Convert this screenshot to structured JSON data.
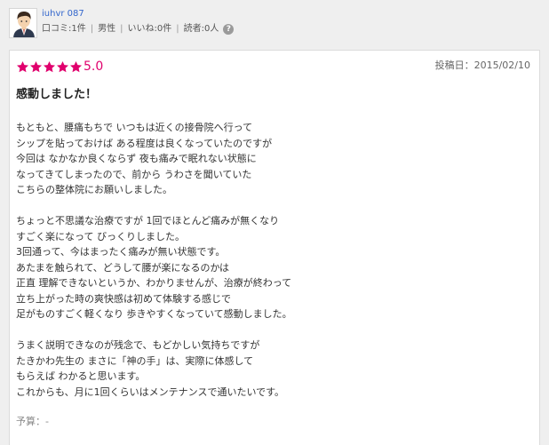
{
  "user": {
    "name": "iuhvr 087",
    "stats": [
      "口コミ:1件",
      "男性",
      "いいね:0件",
      "読者:0人"
    ],
    "help_icon": "question-circle-icon"
  },
  "review": {
    "rating": 5,
    "rating_label": "5.0",
    "post_date": "投稿日：2015/02/10",
    "title": "感動しました！",
    "paragraphs": [
      [
        "もともと、腰痛もちで いつもは近くの接骨院へ行って",
        "シップを貼っておけば ある程度は良くなっていたのですが",
        "今回は なかなか良くならず 夜も痛みで眠れない状態に",
        "なってきてしまったので、前から うわさを聞いていた",
        "こちらの整体院にお願いしました。"
      ],
      [
        "ちょっと不思議な治療ですが 1回でほとんど痛みが無くなり",
        "すごく楽になって びっくりしました。",
        "3回通って、今はまったく痛みが無い状態です。",
        "あたまを触られて、どうして腰が楽になるのかは",
        "正直 理解できないというか、わかりませんが、治療が終わって",
        "立ち上がった時の爽快感は初めて体験する感じで",
        "足がものすごく軽くなり 歩きやすくなっていて感動しました。"
      ],
      [
        "うまく説明できなのが残念で、もどかしい気持ちですが",
        "たきかわ先生の まさに「神の手」は、実際に体感して",
        "もらえば わかると思います。",
        "これからも、月に1回くらいはメンテナンスで通いたいです。"
      ]
    ],
    "budget": "予算：-"
  },
  "colors": {
    "star": "#e0006d",
    "link": "#3366cc",
    "background": "#efefef"
  }
}
